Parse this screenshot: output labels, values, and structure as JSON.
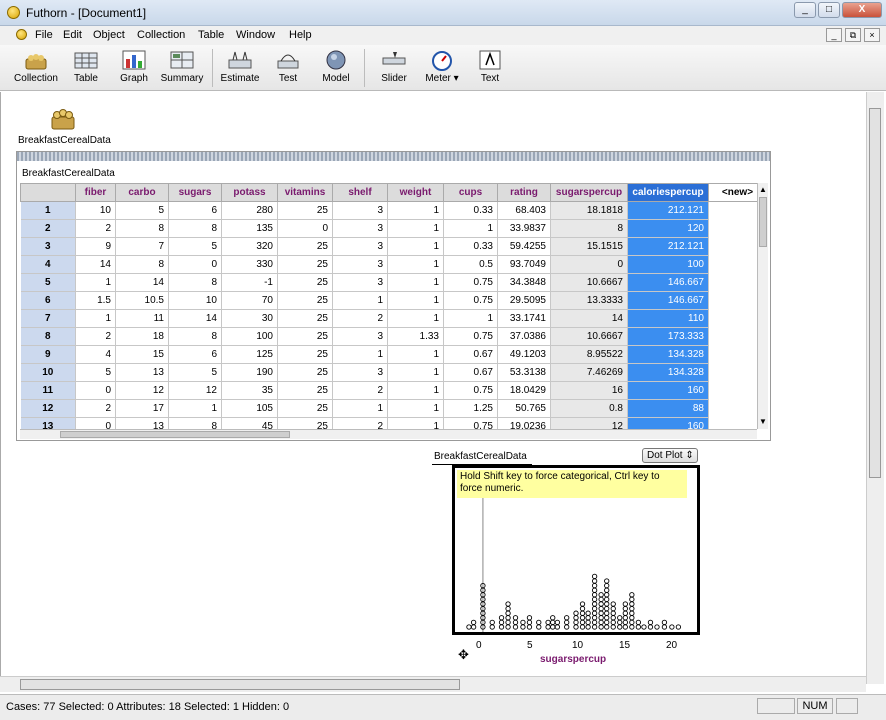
{
  "window": {
    "title": "Futhorn - [Document1]",
    "minimize": "_",
    "maximize": "□",
    "close": "X"
  },
  "menu": [
    "File",
    "Edit",
    "Object",
    "Collection",
    "Table",
    "Window",
    "Help"
  ],
  "mdi": {
    "min": "_",
    "restore": "⧉",
    "close": "×"
  },
  "toolbar": [
    {
      "label": "Collection",
      "icon": "collection-icon"
    },
    {
      "label": "Table",
      "icon": "table-icon"
    },
    {
      "label": "Graph",
      "icon": "graph-icon"
    },
    {
      "label": "Summary",
      "icon": "summary-icon"
    },
    {
      "label": "Estimate",
      "icon": "estimate-icon"
    },
    {
      "label": "Test",
      "icon": "test-icon"
    },
    {
      "label": "Model",
      "icon": "model-icon"
    },
    {
      "label": "Slider",
      "icon": "slider-icon"
    },
    {
      "label": "Meter ▾",
      "icon": "meter-icon"
    },
    {
      "label": "Text",
      "icon": "text-icon"
    }
  ],
  "collection": {
    "name": "BreakfastCerealData"
  },
  "table": {
    "title": "BreakfastCerealData",
    "columns": [
      "fiber",
      "carbo",
      "sugars",
      "potass",
      "vitamins",
      "shelf",
      "weight",
      "cups",
      "rating",
      "sugarspercup",
      "caloriespercup",
      "<new>"
    ],
    "rows": [
      [
        "1",
        "10",
        "5",
        "6",
        "280",
        "25",
        "3",
        "1",
        "0.33",
        "68.403",
        "18.1818",
        "212.121"
      ],
      [
        "2",
        "2",
        "8",
        "8",
        "135",
        "0",
        "3",
        "1",
        "1",
        "33.9837",
        "8",
        "120"
      ],
      [
        "3",
        "9",
        "7",
        "5",
        "320",
        "25",
        "3",
        "1",
        "0.33",
        "59.4255",
        "15.1515",
        "212.121"
      ],
      [
        "4",
        "14",
        "8",
        "0",
        "330",
        "25",
        "3",
        "1",
        "0.5",
        "93.7049",
        "0",
        "100"
      ],
      [
        "5",
        "1",
        "14",
        "8",
        "-1",
        "25",
        "3",
        "1",
        "0.75",
        "34.3848",
        "10.6667",
        "146.667"
      ],
      [
        "6",
        "1.5",
        "10.5",
        "10",
        "70",
        "25",
        "1",
        "1",
        "0.75",
        "29.5095",
        "13.3333",
        "146.667"
      ],
      [
        "7",
        "1",
        "11",
        "14",
        "30",
        "25",
        "2",
        "1",
        "1",
        "33.1741",
        "14",
        "110"
      ],
      [
        "8",
        "2",
        "18",
        "8",
        "100",
        "25",
        "3",
        "1.33",
        "0.75",
        "37.0386",
        "10.6667",
        "173.333"
      ],
      [
        "9",
        "4",
        "15",
        "6",
        "125",
        "25",
        "1",
        "1",
        "0.67",
        "49.1203",
        "8.95522",
        "134.328"
      ],
      [
        "10",
        "5",
        "13",
        "5",
        "190",
        "25",
        "3",
        "1",
        "0.67",
        "53.3138",
        "7.46269",
        "134.328"
      ],
      [
        "11",
        "0",
        "12",
        "12",
        "35",
        "25",
        "2",
        "1",
        "0.75",
        "18.0429",
        "16",
        "160"
      ],
      [
        "12",
        "2",
        "17",
        "1",
        "105",
        "25",
        "1",
        "1",
        "1.25",
        "50.765",
        "0.8",
        "88"
      ],
      [
        "13",
        "0",
        "13",
        "8",
        "45",
        "25",
        "2",
        "1",
        "0.75",
        "19.0236",
        "12",
        "160"
      ]
    ]
  },
  "graph": {
    "name": "BreakfastCerealData",
    "type_button": "Dot Plot ⇕",
    "hint": "Hold Shift key to force categorical, Ctrl key to force numeric.",
    "x_label": "sugarspercup",
    "x_ticks": [
      "0",
      "5",
      "10",
      "15",
      "20"
    ]
  },
  "chart_data": {
    "type": "scatter",
    "subtype": "dot plot",
    "xlabel": "sugarspercup",
    "xlim": [
      -3,
      23
    ],
    "x_ticks": [
      0,
      5,
      10,
      15,
      20
    ],
    "stacks": [
      {
        "x": -1.5,
        "n": 1
      },
      {
        "x": -1,
        "n": 2
      },
      {
        "x": 0,
        "n": 10
      },
      {
        "x": 1,
        "n": 2
      },
      {
        "x": 2,
        "n": 3
      },
      {
        "x": 2.7,
        "n": 6
      },
      {
        "x": 3.5,
        "n": 3
      },
      {
        "x": 4.3,
        "n": 2
      },
      {
        "x": 5,
        "n": 3
      },
      {
        "x": 6,
        "n": 2
      },
      {
        "x": 7,
        "n": 2
      },
      {
        "x": 7.5,
        "n": 3
      },
      {
        "x": 8,
        "n": 2
      },
      {
        "x": 9,
        "n": 3
      },
      {
        "x": 10,
        "n": 4
      },
      {
        "x": 10.7,
        "n": 6
      },
      {
        "x": 11.3,
        "n": 4
      },
      {
        "x": 12,
        "n": 12
      },
      {
        "x": 12.7,
        "n": 8
      },
      {
        "x": 13.3,
        "n": 11
      },
      {
        "x": 14,
        "n": 6
      },
      {
        "x": 14.7,
        "n": 3
      },
      {
        "x": 15.3,
        "n": 6
      },
      {
        "x": 16,
        "n": 8
      },
      {
        "x": 16.7,
        "n": 2
      },
      {
        "x": 17.3,
        "n": 1
      },
      {
        "x": 18,
        "n": 2
      },
      {
        "x": 18.7,
        "n": 1
      },
      {
        "x": 19.5,
        "n": 2
      },
      {
        "x": 20.3,
        "n": 1
      },
      {
        "x": 21,
        "n": 1
      }
    ]
  },
  "status": {
    "text": "Cases: 77   Selected: 0   Attributes: 18   Selected: 1   Hidden: 0",
    "num": "NUM"
  }
}
